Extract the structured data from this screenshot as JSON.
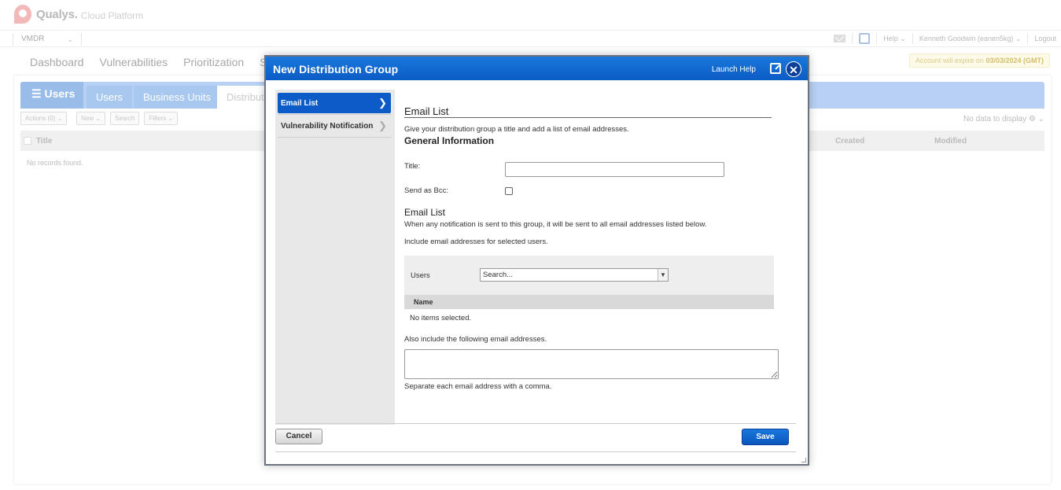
{
  "brand": {
    "name": "Qualys.",
    "subtitle": "Cloud Platform"
  },
  "menubar": {
    "module": "VMDR",
    "help": "Help",
    "user": "Kenneth Goodwin (eanen5kg)",
    "logout": "Logout"
  },
  "nav": {
    "tabs": [
      "Dashboard",
      "Vulnerabilities",
      "Prioritization",
      "Scar"
    ],
    "expire_prefix": "Account will expire on",
    "expire_date": "03/03/2024 (GMT)"
  },
  "panel": {
    "users_heading": "Users",
    "tabs": [
      "Users",
      "Business Units",
      "Distributi"
    ],
    "toolbar": {
      "actions": "Actions (0)",
      "new": "New",
      "search": "Search",
      "filters": "Filters"
    },
    "no_data": "No data to display",
    "columns": {
      "title": "Title",
      "created": "Created",
      "modified": "Modified"
    },
    "no_records": "No records found."
  },
  "modal": {
    "title": "New Distribution Group",
    "launch_help": "Launch Help",
    "side_items": [
      "Email List",
      "Vulnerability Notification"
    ],
    "heading": "Email List",
    "intro": "Give your distribution group a title and add a list of email addresses.",
    "general_info": "General Information",
    "title_label": "Title:",
    "title_value": "",
    "bcc_label": "Send as Bcc:",
    "email_list_heading": "Email List",
    "email_list_desc": "When any notification is sent to this group, it will be sent to all email addresses listed below.",
    "include_users_desc": "Include email addresses for selected users.",
    "users_label": "Users",
    "users_select_value": "Search...",
    "name_column": "Name",
    "no_items": "No items selected.",
    "also_include": "Also include the following email addresses.",
    "emails_value": "",
    "separate_hint": "Separate each email address with a comma.",
    "cancel": "Cancel",
    "save": "Save"
  }
}
